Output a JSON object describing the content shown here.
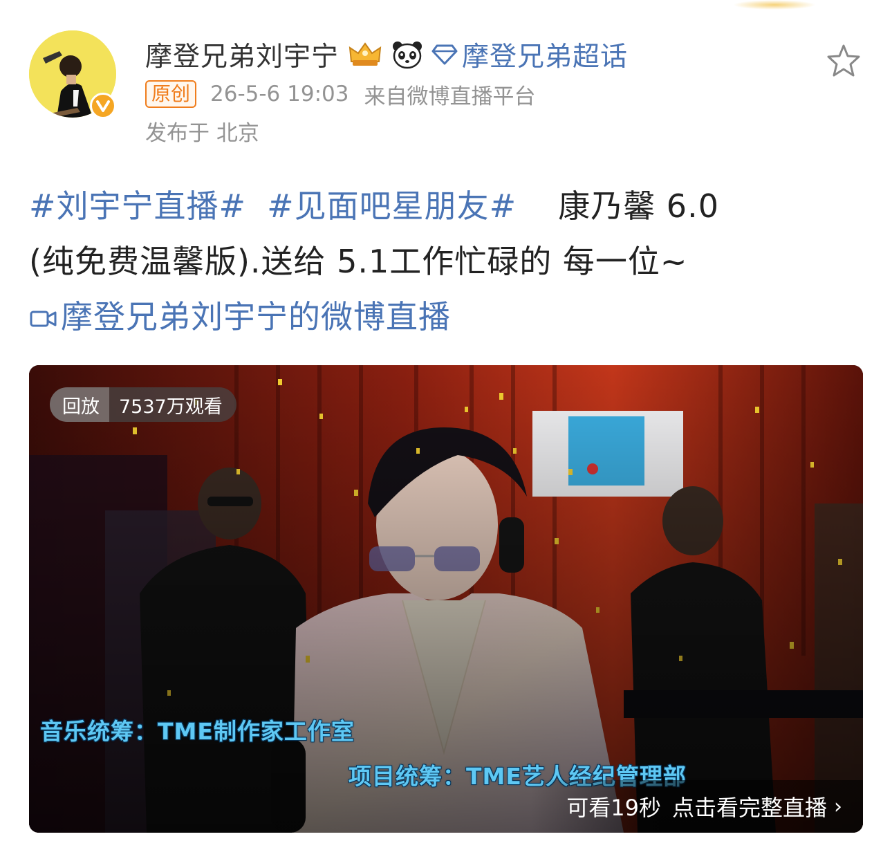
{
  "post": {
    "username": "摩登兄弟刘宇宁",
    "super_topic": "摩登兄弟超话",
    "original_tag": "原创",
    "time": "26-5-6 19:03",
    "source": "来自微博直播平台",
    "location": "发布于 北京",
    "hashtags": [
      "#刘宇宁直播#",
      "#见面吧星朋友#"
    ],
    "text_line1": "康乃馨 6.0",
    "text_line2": "(纯免费温馨版).送给 5.1工作忙碌的 每一位~",
    "live_link": "摩登兄弟刘宇宁的微博直播"
  },
  "video": {
    "replay_label": "回放",
    "views": "7537万观看",
    "caption_music": "音乐统筹：TME制作家工作室",
    "caption_project": "项目统筹：TME艺人经纪管理部",
    "preview_seconds": "可看19秒",
    "watch_full": "点击看完整直播"
  },
  "colors": {
    "link_blue": "#4a74b5",
    "orange_tag": "#f07d1c",
    "meta_gray": "#939393",
    "caption_cyan": "#5ec8f4",
    "verified_gold": "#f5a623"
  },
  "icons": [
    "verified-v-icon",
    "crown-badge-icon",
    "panda-badge-icon",
    "diamond-icon",
    "star-icon",
    "video-camera-icon",
    "chevron-right-icon"
  ]
}
